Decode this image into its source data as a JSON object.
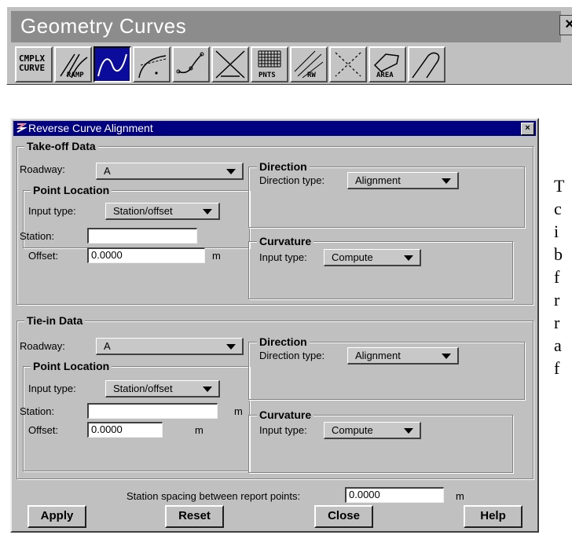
{
  "toolbar": {
    "title": "Geometry Curves",
    "close": "×",
    "tools": [
      {
        "name": "complex-curve",
        "label": "CMPLX CURVE",
        "icon": "complex-curve-icon"
      },
      {
        "name": "ramp",
        "label": "RAMP",
        "icon": "ramp-icon"
      },
      {
        "name": "reverse-curve",
        "label": "",
        "icon": "reverse-curve-icon",
        "active": true
      },
      {
        "name": "curve-point",
        "label": "",
        "icon": "curve-point-icon"
      },
      {
        "name": "spiral-points",
        "label": "",
        "icon": "spiral-points-icon"
      },
      {
        "name": "triangle-x",
        "label": "",
        "icon": "triangle-x-icon"
      },
      {
        "name": "points-grid",
        "label": "PNTS",
        "icon": "points-grid-icon"
      },
      {
        "name": "right-of-way",
        "label": "RW",
        "icon": "right-of-way-icon"
      },
      {
        "name": "dotted-cross",
        "label": "",
        "icon": "dotted-cross-icon"
      },
      {
        "name": "area",
        "label": "AREA",
        "icon": "area-icon"
      },
      {
        "name": "hook-curve",
        "label": "",
        "icon": "hook-curve-icon"
      }
    ]
  },
  "dialog": {
    "title": "Reverse Curve Alignment",
    "close": "×",
    "takeoff": {
      "title": "Take-off Data",
      "roadway_label": "Roadway:",
      "roadway_value": "A",
      "point_location": {
        "title": "Point Location",
        "input_type_label": "Input type:",
        "input_type_value": "Station/offset",
        "station_label": "Station:",
        "station_value": "",
        "offset_label": "Offset:",
        "offset_value": "0.0000",
        "offset_unit": "m"
      },
      "direction": {
        "title": "Direction",
        "type_label": "Direction type:",
        "type_value": "Alignment"
      },
      "curvature": {
        "title": "Curvature",
        "input_label": "Input type:",
        "input_value": "Compute"
      }
    },
    "tiein": {
      "title": "Tie-in Data",
      "roadway_label": "Roadway:",
      "roadway_value": "A",
      "point_location": {
        "title": "Point Location",
        "input_type_label": "Input type:",
        "input_type_value": "Station/offset",
        "station_label": "Station:",
        "station_value": "",
        "station_unit": "m",
        "offset_label": "Offset:",
        "offset_value": "0.0000",
        "offset_unit": "m"
      },
      "direction": {
        "title": "Direction",
        "type_label": "Direction type:",
        "type_value": "Alignment"
      },
      "curvature": {
        "title": "Curvature",
        "input_label": "Input type:",
        "input_value": "Compute"
      }
    },
    "spacing": {
      "label": "Station spacing between report points:",
      "value": "0.0000",
      "unit": "m"
    },
    "buttons": {
      "apply": "Apply",
      "reset": "Reset",
      "close": "Close",
      "help": "Help"
    }
  },
  "side_text": [
    "T",
    "c",
    "i",
    "b",
    "f",
    "r",
    "r",
    "a",
    "f"
  ]
}
